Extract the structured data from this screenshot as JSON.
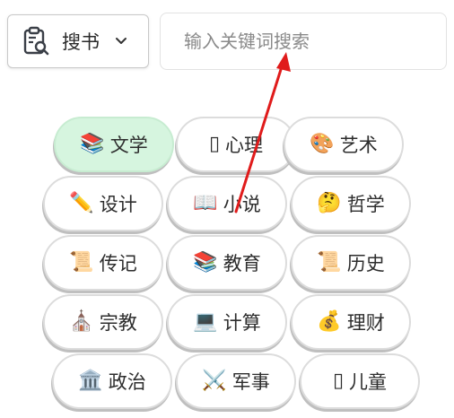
{
  "search_type": {
    "label": "搜书",
    "icon": "clipboard-search-icon",
    "chevron": "chevron-down-icon"
  },
  "search": {
    "placeholder": "输入关键词搜索",
    "value": ""
  },
  "categories": [
    {
      "emoji": "📚",
      "label": "文学",
      "selected": true
    },
    {
      "emoji": "",
      "label": "心理",
      "selected": false
    },
    {
      "emoji": "🎨",
      "label": "艺术",
      "selected": false
    },
    {
      "emoji": "✏️",
      "label": "设计",
      "selected": false
    },
    {
      "emoji": "📖",
      "label": "小说",
      "selected": false
    },
    {
      "emoji": "🤔",
      "label": "哲学",
      "selected": false
    },
    {
      "emoji": "📜",
      "label": "传记",
      "selected": false
    },
    {
      "emoji": "📚",
      "label": "教育",
      "selected": false
    },
    {
      "emoji": "📜",
      "label": "历史",
      "selected": false
    },
    {
      "emoji": "⛪",
      "label": "宗教",
      "selected": false
    },
    {
      "emoji": "💻",
      "label": "计算",
      "selected": false
    },
    {
      "emoji": "💰",
      "label": "理财",
      "selected": false
    },
    {
      "emoji": "🏛️",
      "label": "政治",
      "selected": false
    },
    {
      "emoji": "⚔️",
      "label": "军事",
      "selected": false
    },
    {
      "emoji": "",
      "label": "儿童",
      "selected": false
    }
  ],
  "colors": {
    "selected_bg": "#d6f5df",
    "arrow": "#e01b1b"
  }
}
